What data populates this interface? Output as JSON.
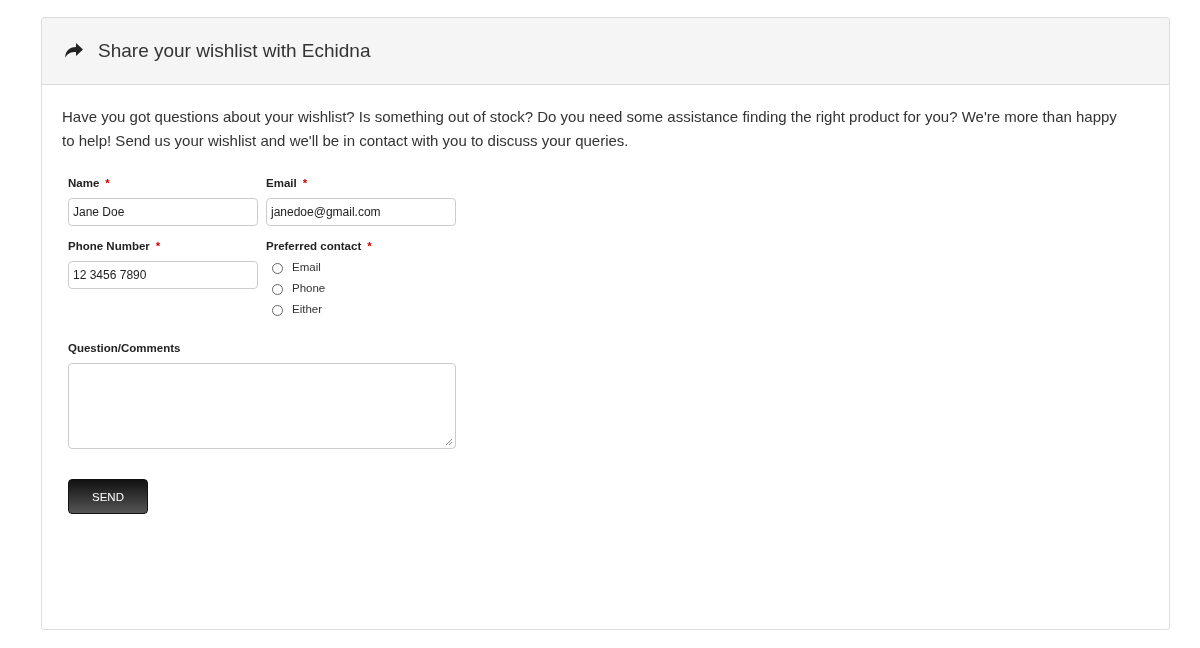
{
  "panel": {
    "title": "Share your wishlist with Echidna"
  },
  "intro": "Have you got questions about your wishlist? Is something out of stock? Do you need some assistance finding the right product for you? We're more than happy to help! Send us your wishlist and we'll be in contact with you to discuss your queries.",
  "fields": [
    {
      "kind": "text",
      "label": "Name",
      "required_mark": "*",
      "value": "Jane Doe"
    },
    {
      "kind": "text",
      "label": "Email",
      "required_mark": "*",
      "value": "janedoe@gmail.com"
    },
    {
      "kind": "text",
      "label": "Phone Number",
      "required_mark": "*",
      "value": "12 3456 7890"
    },
    {
      "kind": "radio",
      "label": "Preferred contact",
      "required_mark": "*",
      "options": [
        {
          "label": "Email",
          "selected": false
        },
        {
          "label": "Phone",
          "selected": false
        },
        {
          "label": "Either",
          "selected": false
        }
      ]
    },
    {
      "kind": "textarea",
      "label": "Question/Comments"
    }
  ],
  "submit": {
    "label": "SEND"
  }
}
